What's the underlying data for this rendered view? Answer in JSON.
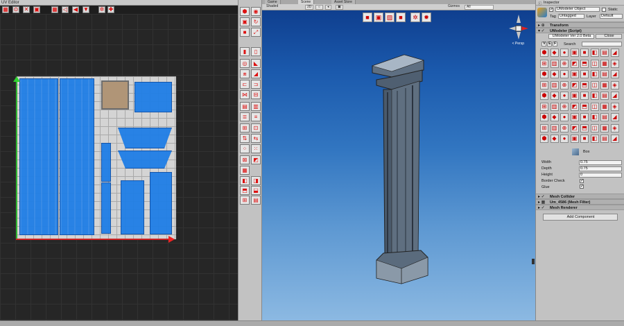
{
  "uv_editor": {
    "tab_title": "UV Editor",
    "toolbar_icons": [
      "grid-icon",
      "select-point-icon",
      "select-edge-icon",
      "select-face-icon",
      "grid-snap-icon",
      "move-left-icon",
      "move-left-solid-icon",
      "move-down-icon",
      "settings-icon",
      "crosshair-icon"
    ]
  },
  "scene": {
    "tabs": [
      "Game",
      "Scene",
      "Asset Store"
    ],
    "shading_mode": "Shaded",
    "mode_2d": "2D",
    "gizmos_label": "Gizmos",
    "search_placeholder": "All",
    "camera_label": "< Persp"
  },
  "inspector": {
    "tab_title": "Inspector",
    "object_name": "UModeler Object",
    "static_label": "Static",
    "tag_label": "Tag",
    "tag_value": "Untagged",
    "layer_label": "Layer",
    "layer_value": "Default",
    "transform_header": "Transform",
    "umodeler_header": "UModeler (Script)",
    "version_label": "UModeler Ver 2.0 Beta",
    "close_label": "Close",
    "search_label": "Search",
    "view_tabs": [
      "V",
      "E",
      "F"
    ],
    "shape_name": "Box",
    "properties": [
      {
        "label": "Width",
        "value": "0.75"
      },
      {
        "label": "Depth",
        "value": "0.75"
      },
      {
        "label": "Height",
        "value": "0"
      }
    ],
    "border_check_label": "Border Check",
    "border_check_value": true,
    "glue_label": "Glue",
    "glue_value": true,
    "components": [
      "Mesh Collider",
      "Um_4586 (Mesh Filter)",
      "Mesh Renderer"
    ],
    "add_component_label": "Add Component"
  },
  "colors": {
    "uv_island": "#1f7ee6",
    "accent_red": "#d11111",
    "sky_top": "#0f3f8f",
    "sky_bottom": "#8cb9e2"
  }
}
